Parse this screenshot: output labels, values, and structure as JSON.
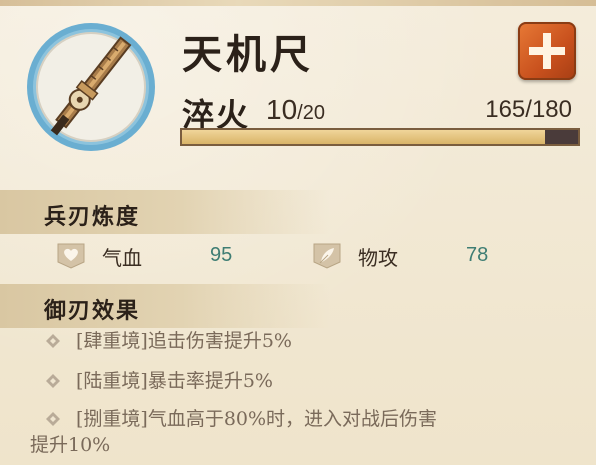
{
  "item": {
    "name": "天机尺",
    "icon": "ruler-blade-icon"
  },
  "temper": {
    "label": "淬火",
    "level": "10",
    "max_level": "/20",
    "exp": "165/180",
    "exp_current": 165,
    "exp_max": 180
  },
  "add_button": {
    "icon": "plus-icon",
    "color": "#d8612a"
  },
  "refine": {
    "header": "兵刃炼度",
    "stats": [
      {
        "icon": "heart-icon",
        "label": "气血",
        "value": "95"
      },
      {
        "icon": "feather-icon",
        "label": "物攻",
        "value": "78"
      }
    ]
  },
  "effects": {
    "header": "御刃效果",
    "items": [
      {
        "text": "[肆重境]追击伤害提升5%"
      },
      {
        "text": "[陆重境]暴击率提升5%"
      },
      {
        "text": "[捌重境]气血高于80%时，进入对战后伤害",
        "continuation": "提升10%"
      }
    ]
  },
  "colors": {
    "stat_value": "#3e7d73",
    "effect_text": "#7a6a5a",
    "progress_fill": "#e6c27e",
    "progress_track": "#4a3b3a"
  }
}
